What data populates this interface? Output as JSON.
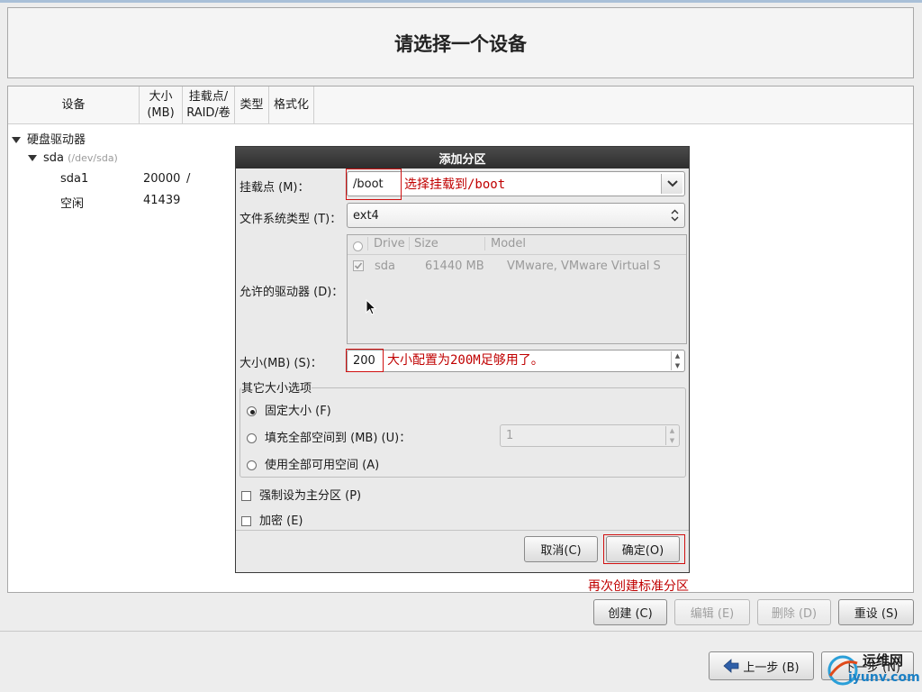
{
  "title": "请选择一个设备",
  "columns": [
    "设备",
    "大小\n(MB)",
    "挂载点/\nRAID/卷",
    "类型",
    "格式化"
  ],
  "tree": {
    "group_label": "硬盘驱动器",
    "disk": {
      "name": "sda",
      "path": "(/dev/sda)"
    },
    "rows": [
      {
        "name": "sda1",
        "size": "20000",
        "mount": "/"
      },
      {
        "name": "空闲",
        "size": "41439",
        "mount": ""
      }
    ]
  },
  "dialog": {
    "title": "添加分区",
    "mount_label": "挂载点 (M)：",
    "mount_value": "/boot",
    "fs_label": "文件系统类型 (T)：",
    "fs_value": "ext4",
    "drives_label": "允许的驱动器 (D)：",
    "drive_columns": [
      "Drive",
      "Size",
      "Model"
    ],
    "drive_row": {
      "drive": "sda",
      "size": "61440 MB",
      "model": "VMware, VMware Virtual S"
    },
    "size_label": "大小(MB) (S)：",
    "size_value": "200",
    "options_title": "其它大小选项",
    "opt_fixed": "固定大小 (F)",
    "opt_fill": "填充全部空间到 (MB) (U)：",
    "opt_fill_value": "1",
    "opt_all": "使用全部可用空间 (A)",
    "force_primary": "强制设为主分区 (P)",
    "encrypt": "加密 (E)",
    "cancel": "取消(C)",
    "ok": "确定(O)"
  },
  "annotations": {
    "mount_note": "选择挂载到/boot",
    "size_note": "大小配置为200M足够用了。",
    "create_note": "再次创建标准分区"
  },
  "buttons": {
    "create": "创建 (C)",
    "edit": "编辑 (E)",
    "delete": "删除 (D)",
    "reset": "重设 (S)",
    "back": "上一步 (B)",
    "next": "下一步 (N)"
  },
  "watermark": {
    "text1": "运维网",
    "text2": "iyunv.com"
  },
  "colors": {
    "annotation": "#c00000",
    "title_bar": "#2d2d2d",
    "background": "#ededed"
  }
}
